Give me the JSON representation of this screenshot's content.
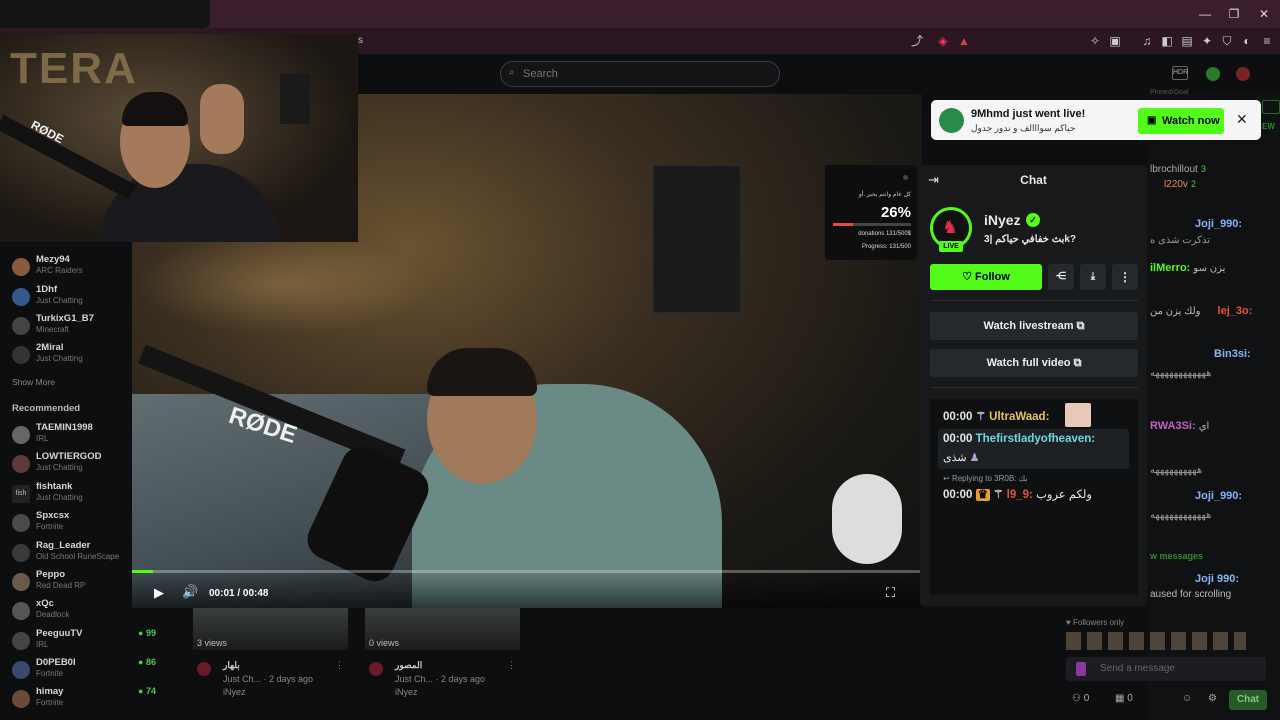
{
  "browser": {
    "address_suffix": "s"
  },
  "search": {
    "placeholder": "Search"
  },
  "sidebar": {
    "following": [
      {
        "name": "Mezy94",
        "category": "ARC Raiders"
      },
      {
        "name": "1Dhf",
        "category": "Just Chatting"
      },
      {
        "name": "TurkixG1_B7",
        "category": "Minecraft"
      },
      {
        "name": "2Miral",
        "category": "Just Chatting"
      }
    ],
    "show_more": "Show More",
    "recommended_title": "Recommended",
    "recommended": [
      {
        "name": "TAEMIN1998",
        "category": "IRL"
      },
      {
        "name": "LOWTIERGOD",
        "category": "Just Chatting"
      },
      {
        "name": "fishtank",
        "category": "Just Chatting"
      },
      {
        "name": "Spxcsx",
        "category": "Fortnite"
      },
      {
        "name": "Rag_Leader",
        "category": "Old School RuneScape"
      },
      {
        "name": "Peppo",
        "category": "Red Dead RP"
      },
      {
        "name": "xQc",
        "category": "Deadlock"
      },
      {
        "name": "PeeguuTV",
        "category": "IRL",
        "count": "99"
      },
      {
        "name": "D0PEB0I",
        "category": "Fortnite",
        "count": "86"
      },
      {
        "name": "himay",
        "category": "Fortnite",
        "count": "74"
      }
    ]
  },
  "video": {
    "time": "00:01 / 00:48",
    "progress": 0.027
  },
  "donation": {
    "header": "كل عام وانتم بخير .أو",
    "percent": "26%",
    "donations": "donations 131/500$",
    "progress_text": "Progress: 131/500"
  },
  "notification": {
    "title": "9Mhmd just went live!",
    "subtitle": "حياكم سوااالف و ندور جدول",
    "button": "Watch now"
  },
  "chatpanel": {
    "title": "Chat",
    "channel": "iNyez",
    "stream_title": "بث خفافي حياكم |3k?",
    "live_badge": "LIVE",
    "follow": "Follow",
    "watch_livestream": "Watch livestream",
    "watch_full": "Watch full video",
    "messages": [
      {
        "time": "00:00",
        "user": "UltraWaad:",
        "text": ""
      },
      {
        "time": "00:00",
        "user": "Thefirstladyofheaven:",
        "text": "شذى"
      },
      {
        "reply": "Replying to 3R0B: بك",
        "time": "00:00",
        "user": "l9_9:",
        "text": "ولكم عروب"
      }
    ]
  },
  "right_chat": {
    "top_label": "Pinned/Goal",
    "users": [
      {
        "name": "lbrochillout",
        "n": "3"
      },
      {
        "name": "l220v",
        "n": "2"
      }
    ],
    "lines": [
      {
        "user": "Joji_990:",
        "text": "تذكرت شذى ه"
      },
      {
        "user": "ilMerro:",
        "text": "يزن سو"
      },
      {
        "user": "lej_3o:",
        "text": "ولك يزن من"
      },
      {
        "user": "Bin3si:",
        "text": "ههههههههههههه"
      },
      {
        "user": "RWA3Si:",
        "text": "اي"
      },
      {
        "user": "",
        "text": "ههههههههههه"
      },
      {
        "user": "Joji_990:",
        "text": "ههههههههههههه"
      },
      {
        "user": "Joji 990:",
        "text": "aused for scrolling"
      }
    ],
    "new_messages": "w messages",
    "followers_only": "Followers only",
    "send_placeholder": "Send a message",
    "count": "0",
    "chat_button": "Chat"
  },
  "cards": [
    {
      "views": "3 views",
      "title": "بلهار",
      "meta": "Just Ch...  ·  2 days ago",
      "channel": "iNyez"
    },
    {
      "views": "0 views",
      "title": "المصور",
      "meta": "Just Ch...  ·  2 days ago",
      "channel": "iNyez"
    }
  ],
  "colors": {
    "accent": "#53fc18",
    "panel": "#17191b",
    "browser": "#3a1e2c"
  }
}
